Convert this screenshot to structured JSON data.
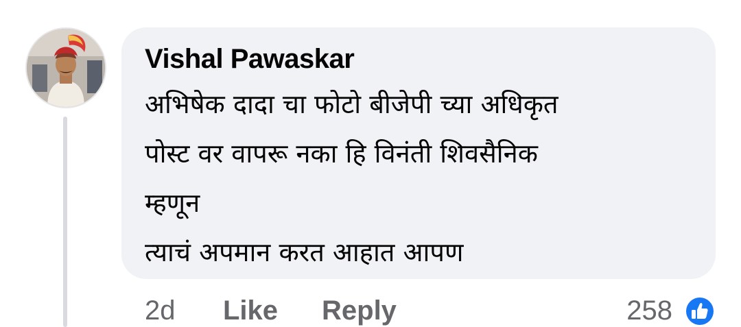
{
  "comment": {
    "author": "Vishal Pawaskar",
    "body_lines": [
      "अभिषेक दादा चा फोटो बीजेपी च्या अधिकृत",
      "पोस्ट वर वापरू नका हि विनंती शिवसैनिक",
      "म्हणून",
      "त्याचं अपमान करत आहात आपण"
    ]
  },
  "actions": {
    "time": "2d",
    "like_label": "Like",
    "reply_label": "Reply",
    "reaction_count": "258"
  },
  "icons": {
    "avatar": "user-avatar",
    "reaction": "thumbs-up-icon"
  },
  "colors": {
    "bubble": "#f0f2f5",
    "text": "#050505",
    "muted": "#65676b",
    "like_blue": "#1877f2"
  }
}
